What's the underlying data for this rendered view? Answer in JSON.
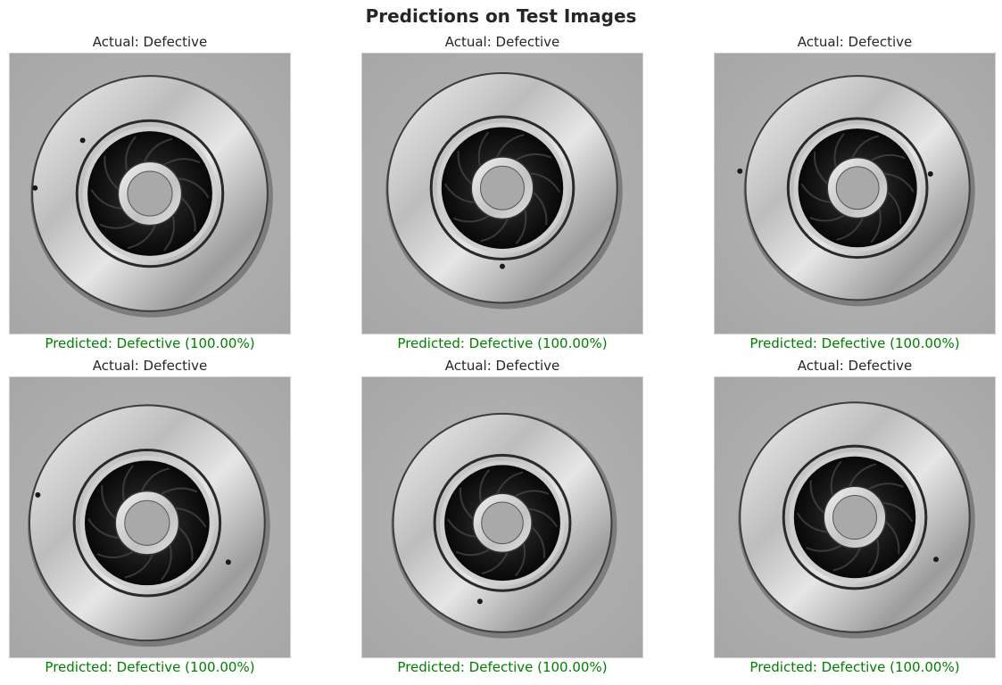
{
  "figure": {
    "title": "Predictions on Test Images",
    "prediction_color": "#008000"
  },
  "panels": [
    {
      "actual": "Actual: Defective",
      "predicted": "Predicted: Defective (100.00%)",
      "image": "metal-impeller-casting-photo"
    },
    {
      "actual": "Actual: Defective",
      "predicted": "Predicted: Defective (100.00%)",
      "image": "metal-impeller-casting-photo"
    },
    {
      "actual": "Actual: Defective",
      "predicted": "Predicted: Defective (100.00%)",
      "image": "metal-impeller-casting-photo"
    },
    {
      "actual": "Actual: Defective",
      "predicted": "Predicted: Defective (100.00%)",
      "image": "metal-impeller-casting-photo"
    },
    {
      "actual": "Actual: Defective",
      "predicted": "Predicted: Defective (100.00%)",
      "image": "metal-impeller-casting-photo"
    },
    {
      "actual": "Actual: Defective",
      "predicted": "Predicted: Defective (100.00%)",
      "image": "metal-impeller-casting-photo"
    }
  ]
}
